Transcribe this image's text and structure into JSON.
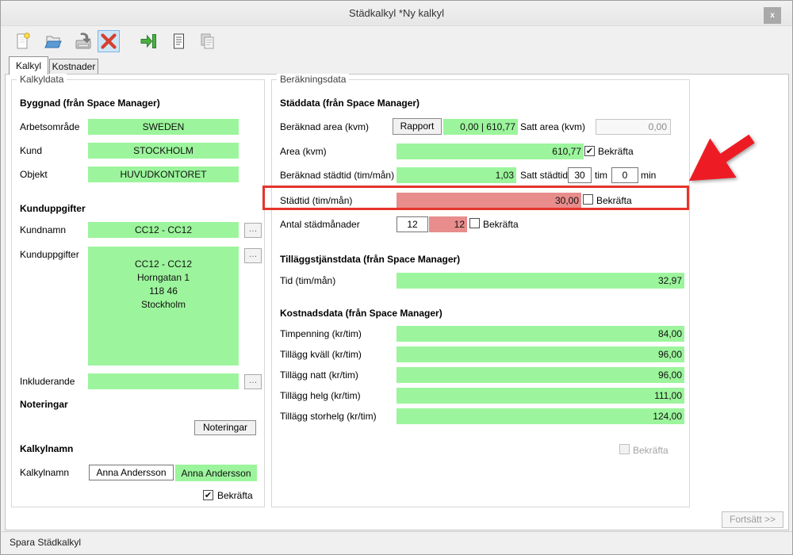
{
  "window": {
    "title": "Städkalkyl *Ny kalkyl",
    "status_text": "Spara Städkalkyl"
  },
  "glyphs": {
    "check": "✔",
    "ellipsis": "…",
    "close": "x"
  },
  "toolbar": {
    "buttons": [
      {
        "icon": "new-document"
      },
      {
        "icon": "open-folder"
      },
      {
        "icon": "save"
      },
      {
        "icon": "delete",
        "active": true
      },
      {
        "icon": "export"
      },
      {
        "icon": "report"
      },
      {
        "icon": "copy"
      }
    ]
  },
  "tabs": {
    "kalkyl": "Kalkyl",
    "kostnader": "Kostnader"
  },
  "kalkyldata": {
    "group_title": "Kalkyldata",
    "byggnad_heading": "Byggnad (från Space Manager)",
    "building_rows": [
      {
        "label": "Arbetsområde",
        "value": "SWEDEN"
      },
      {
        "label": "Kund",
        "value": "STOCKHOLM"
      },
      {
        "label": "Objekt",
        "value": "HUVUDKONTORET"
      }
    ],
    "kunduppgifter_heading": "Kunduppgifter",
    "kundnamn_label": "Kundnamn",
    "kundnamn_value": "CC12 - CC12",
    "kunduppgifter_label": "Kunduppgifter",
    "address_lines": [
      "CC12 - CC12",
      "Horngatan 1",
      "118 46",
      "Stockholm"
    ],
    "inkluderande_label": "Inkluderande",
    "inkluderande_value": "",
    "noteringar_heading": "Noteringar",
    "noteringar_button": "Noteringar",
    "kalkylnamn_heading": "Kalkylnamn",
    "kalkylnamn_label": "Kalkylnamn",
    "kalkylnamn_input": "Anna Andersson",
    "kalkylnamn_confirmed": "Anna Andersson",
    "bekrafta_label": "Bekräfta"
  },
  "berakningsdata": {
    "group_title": "Beräkningsdata",
    "staddata_heading": "Städdata (från Space Manager)",
    "beraknad_area_label": "Beräknad area (kvm)",
    "rapport_button": "Rapport",
    "beraknad_area_value": "0,00 | 610,77",
    "satt_area_label": "Satt area (kvm)",
    "satt_area_value": "0,00",
    "area_label": "Area (kvm)",
    "area_value": "610,77",
    "bekrafta_label": "Bekräfta",
    "beraknad_stadtid_label": "Beräknad städtid (tim/mån)",
    "beraknad_stadtid_value": "1,03",
    "satt_stadtid_label": "Satt städtid",
    "satt_stadtid_tim": "30",
    "tim_label": "tim",
    "satt_stadtid_min": "0",
    "min_label": "min",
    "stadtid_label": "Städtid (tim/mån)",
    "stadtid_value": "30,00",
    "manader_label": "Antal städmånader",
    "manader_input": "12",
    "manader_value": "12",
    "tillagg_heading": "Tilläggstjänstdata (från Space Manager)",
    "tid_label": "Tid (tim/mån)",
    "tid_value": "32,97",
    "kostnad_heading": "Kostnadsdata (från Space Manager)",
    "cost_rows": [
      {
        "label": "Timpenning (kr/tim)",
        "value": "84,00"
      },
      {
        "label": "Tillägg kväll (kr/tim)",
        "value": "96,00"
      },
      {
        "label": "Tillägg natt (kr/tim)",
        "value": "96,00"
      },
      {
        "label": "Tillägg helg (kr/tim)",
        "value": "111,00"
      },
      {
        "label": "Tillägg storhelg (kr/tim)",
        "value": "124,00"
      }
    ]
  },
  "footer": {
    "fortsatt_button": "Fortsätt >>"
  },
  "colors": {
    "field_green": "#9cf59c",
    "field_red": "#e88c8c",
    "highlight_red": "#e5342b",
    "toolbar_active_bg": "#cde6f7"
  }
}
